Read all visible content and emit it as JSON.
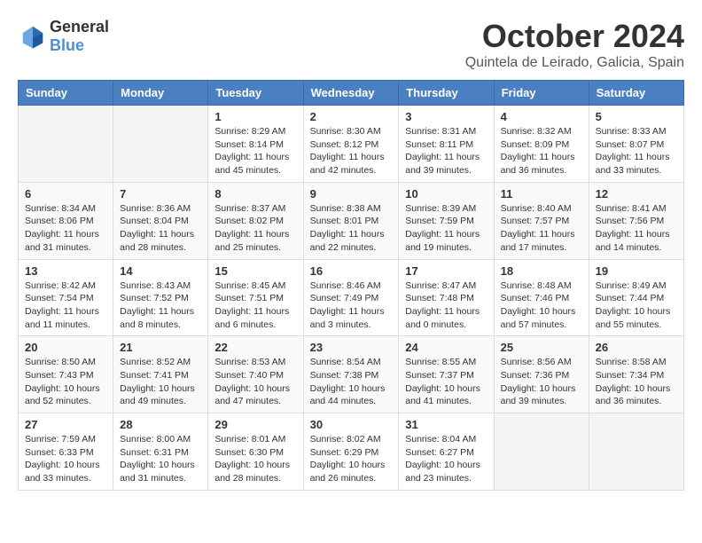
{
  "logo": {
    "general": "General",
    "blue": "Blue"
  },
  "title": {
    "month": "October 2024",
    "location": "Quintela de Leirado, Galicia, Spain"
  },
  "weekdays": [
    "Sunday",
    "Monday",
    "Tuesday",
    "Wednesday",
    "Thursday",
    "Friday",
    "Saturday"
  ],
  "weeks": [
    [
      {
        "day": "",
        "info": ""
      },
      {
        "day": "",
        "info": ""
      },
      {
        "day": "1",
        "info": "Sunrise: 8:29 AM\nSunset: 8:14 PM\nDaylight: 11 hours and 45 minutes."
      },
      {
        "day": "2",
        "info": "Sunrise: 8:30 AM\nSunset: 8:12 PM\nDaylight: 11 hours and 42 minutes."
      },
      {
        "day": "3",
        "info": "Sunrise: 8:31 AM\nSunset: 8:11 PM\nDaylight: 11 hours and 39 minutes."
      },
      {
        "day": "4",
        "info": "Sunrise: 8:32 AM\nSunset: 8:09 PM\nDaylight: 11 hours and 36 minutes."
      },
      {
        "day": "5",
        "info": "Sunrise: 8:33 AM\nSunset: 8:07 PM\nDaylight: 11 hours and 33 minutes."
      }
    ],
    [
      {
        "day": "6",
        "info": "Sunrise: 8:34 AM\nSunset: 8:06 PM\nDaylight: 11 hours and 31 minutes."
      },
      {
        "day": "7",
        "info": "Sunrise: 8:36 AM\nSunset: 8:04 PM\nDaylight: 11 hours and 28 minutes."
      },
      {
        "day": "8",
        "info": "Sunrise: 8:37 AM\nSunset: 8:02 PM\nDaylight: 11 hours and 25 minutes."
      },
      {
        "day": "9",
        "info": "Sunrise: 8:38 AM\nSunset: 8:01 PM\nDaylight: 11 hours and 22 minutes."
      },
      {
        "day": "10",
        "info": "Sunrise: 8:39 AM\nSunset: 7:59 PM\nDaylight: 11 hours and 19 minutes."
      },
      {
        "day": "11",
        "info": "Sunrise: 8:40 AM\nSunset: 7:57 PM\nDaylight: 11 hours and 17 minutes."
      },
      {
        "day": "12",
        "info": "Sunrise: 8:41 AM\nSunset: 7:56 PM\nDaylight: 11 hours and 14 minutes."
      }
    ],
    [
      {
        "day": "13",
        "info": "Sunrise: 8:42 AM\nSunset: 7:54 PM\nDaylight: 11 hours and 11 minutes."
      },
      {
        "day": "14",
        "info": "Sunrise: 8:43 AM\nSunset: 7:52 PM\nDaylight: 11 hours and 8 minutes."
      },
      {
        "day": "15",
        "info": "Sunrise: 8:45 AM\nSunset: 7:51 PM\nDaylight: 11 hours and 6 minutes."
      },
      {
        "day": "16",
        "info": "Sunrise: 8:46 AM\nSunset: 7:49 PM\nDaylight: 11 hours and 3 minutes."
      },
      {
        "day": "17",
        "info": "Sunrise: 8:47 AM\nSunset: 7:48 PM\nDaylight: 11 hours and 0 minutes."
      },
      {
        "day": "18",
        "info": "Sunrise: 8:48 AM\nSunset: 7:46 PM\nDaylight: 10 hours and 57 minutes."
      },
      {
        "day": "19",
        "info": "Sunrise: 8:49 AM\nSunset: 7:44 PM\nDaylight: 10 hours and 55 minutes."
      }
    ],
    [
      {
        "day": "20",
        "info": "Sunrise: 8:50 AM\nSunset: 7:43 PM\nDaylight: 10 hours and 52 minutes."
      },
      {
        "day": "21",
        "info": "Sunrise: 8:52 AM\nSunset: 7:41 PM\nDaylight: 10 hours and 49 minutes."
      },
      {
        "day": "22",
        "info": "Sunrise: 8:53 AM\nSunset: 7:40 PM\nDaylight: 10 hours and 47 minutes."
      },
      {
        "day": "23",
        "info": "Sunrise: 8:54 AM\nSunset: 7:38 PM\nDaylight: 10 hours and 44 minutes."
      },
      {
        "day": "24",
        "info": "Sunrise: 8:55 AM\nSunset: 7:37 PM\nDaylight: 10 hours and 41 minutes."
      },
      {
        "day": "25",
        "info": "Sunrise: 8:56 AM\nSunset: 7:36 PM\nDaylight: 10 hours and 39 minutes."
      },
      {
        "day": "26",
        "info": "Sunrise: 8:58 AM\nSunset: 7:34 PM\nDaylight: 10 hours and 36 minutes."
      }
    ],
    [
      {
        "day": "27",
        "info": "Sunrise: 7:59 AM\nSunset: 6:33 PM\nDaylight: 10 hours and 33 minutes."
      },
      {
        "day": "28",
        "info": "Sunrise: 8:00 AM\nSunset: 6:31 PM\nDaylight: 10 hours and 31 minutes."
      },
      {
        "day": "29",
        "info": "Sunrise: 8:01 AM\nSunset: 6:30 PM\nDaylight: 10 hours and 28 minutes."
      },
      {
        "day": "30",
        "info": "Sunrise: 8:02 AM\nSunset: 6:29 PM\nDaylight: 10 hours and 26 minutes."
      },
      {
        "day": "31",
        "info": "Sunrise: 8:04 AM\nSunset: 6:27 PM\nDaylight: 10 hours and 23 minutes."
      },
      {
        "day": "",
        "info": ""
      },
      {
        "day": "",
        "info": ""
      }
    ]
  ]
}
